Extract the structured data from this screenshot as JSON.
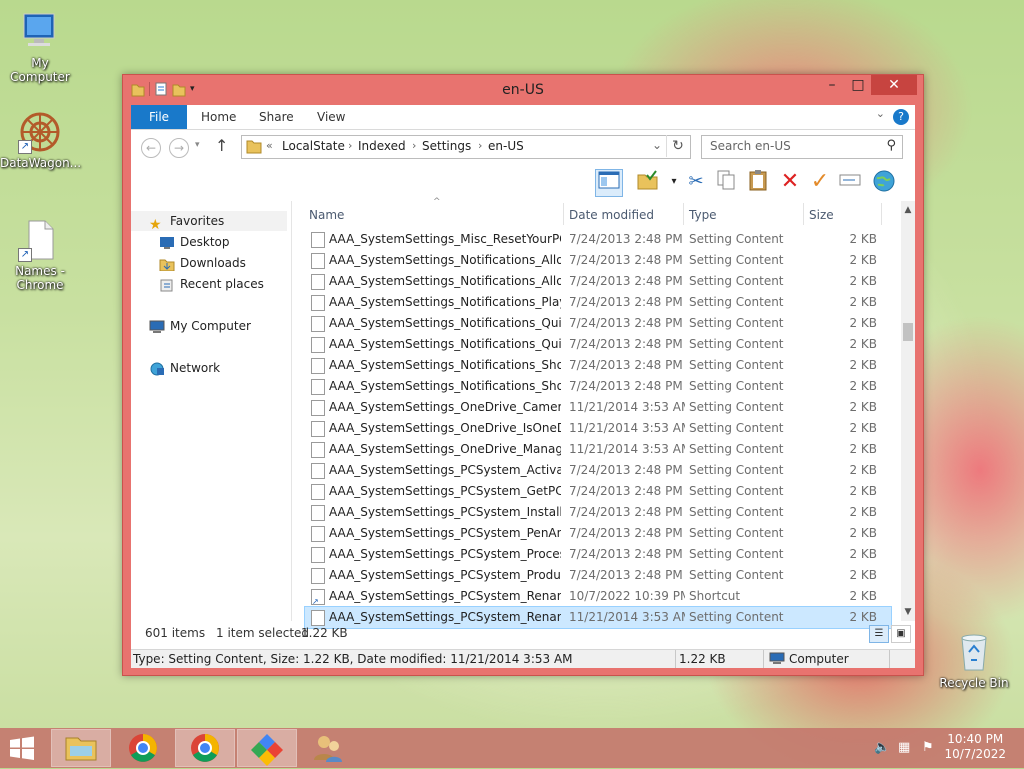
{
  "desktop": {
    "icons": [
      {
        "label": "My Computer"
      },
      {
        "label": "DataWagon..."
      },
      {
        "label": "Names - Chrome"
      },
      {
        "label": "Recycle Bin"
      }
    ]
  },
  "window": {
    "title": "en-US",
    "ribbon_tabs": [
      "File",
      "Home",
      "Share",
      "View"
    ],
    "help_label": "?",
    "address": {
      "prefix": "«",
      "crumbs": [
        "LocalState",
        "Indexed",
        "Settings",
        "en-US"
      ]
    },
    "search_placeholder": "Search en-US",
    "nav_pane": {
      "favorites": "Favorites",
      "favorites_items": [
        "Desktop",
        "Downloads",
        "Recent places"
      ],
      "computer": "My Computer",
      "network": "Network"
    },
    "columns": {
      "name": "Name",
      "date": "Date modified",
      "type": "Type",
      "size": "Size"
    },
    "files": [
      {
        "name": "AAA_SystemSettings_Misc_ResetYourPC",
        "date": "7/24/2013 2:48 PM",
        "type": "Setting Content",
        "size": "2 KB"
      },
      {
        "name": "AAA_SystemSettings_Notifications_Allow...",
        "date": "7/24/2013 2:48 PM",
        "type": "Setting Content",
        "size": "2 KB"
      },
      {
        "name": "AAA_SystemSettings_Notifications_Allow...",
        "date": "7/24/2013 2:48 PM",
        "type": "Setting Content",
        "size": "2 KB"
      },
      {
        "name": "AAA_SystemSettings_Notifications_PlayS...",
        "date": "7/24/2013 2:48 PM",
        "type": "Setting Content",
        "size": "2 KB"
      },
      {
        "name": "AAA_SystemSettings_Notifications_Quiet...",
        "date": "7/24/2013 2:48 PM",
        "type": "Setting Content",
        "size": "2 KB"
      },
      {
        "name": "AAA_SystemSettings_Notifications_Quiet...",
        "date": "7/24/2013 2:48 PM",
        "type": "Setting Content",
        "size": "2 KB"
      },
      {
        "name": "AAA_SystemSettings_Notifications_Show...",
        "date": "7/24/2013 2:48 PM",
        "type": "Setting Content",
        "size": "2 KB"
      },
      {
        "name": "AAA_SystemSettings_Notifications_Show...",
        "date": "7/24/2013 2:48 PM",
        "type": "Setting Content",
        "size": "2 KB"
      },
      {
        "name": "AAA_SystemSettings_OneDrive_CameraR...",
        "date": "11/21/2014 3:53 AM",
        "type": "Setting Content",
        "size": "2 KB"
      },
      {
        "name": "AAA_SystemSettings_OneDrive_IsOneDri...",
        "date": "11/21/2014 3:53 AM",
        "type": "Setting Content",
        "size": "2 KB"
      },
      {
        "name": "AAA_SystemSettings_OneDrive_Manage...",
        "date": "11/21/2014 3:53 AM",
        "type": "Setting Content",
        "size": "2 KB"
      },
      {
        "name": "AAA_SystemSettings_PCSystem_Activate...",
        "date": "7/24/2013 2:48 PM",
        "type": "Setting Content",
        "size": "2 KB"
      },
      {
        "name": "AAA_SystemSettings_PCSystem_GetPCN...",
        "date": "7/24/2013 2:48 PM",
        "type": "Setting Content",
        "size": "2 KB"
      },
      {
        "name": "AAA_SystemSettings_PCSystem_Installed...",
        "date": "7/24/2013 2:48 PM",
        "type": "Setting Content",
        "size": "2 KB"
      },
      {
        "name": "AAA_SystemSettings_PCSystem_PenAnd...",
        "date": "7/24/2013 2:48 PM",
        "type": "Setting Content",
        "size": "2 KB"
      },
      {
        "name": "AAA_SystemSettings_PCSystem_Process...",
        "date": "7/24/2013 2:48 PM",
        "type": "Setting Content",
        "size": "2 KB"
      },
      {
        "name": "AAA_SystemSettings_PCSystem_ProductI...",
        "date": "7/24/2013 2:48 PM",
        "type": "Setting Content",
        "size": "2 KB"
      },
      {
        "name": "AAA_SystemSettings_PCSystem_Rename...",
        "date": "10/7/2022 10:39 PM",
        "type": "Shortcut",
        "size": "2 KB",
        "shortcut": true
      },
      {
        "name": "AAA_SystemSettings_PCSystem_Rename...",
        "date": "11/21/2014 3:53 AM",
        "type": "Setting Content",
        "size": "2 KB",
        "selected": true
      }
    ],
    "status": {
      "count": "601 items",
      "selected": "1 item selected",
      "size": "1.22 KB"
    },
    "details_bar": {
      "info": "Type: Setting Content, Size: 1.22 KB, Date modified: 11/21/2014 3:53 AM",
      "size": "1.22 KB",
      "location": "Computer"
    }
  },
  "taskbar": {
    "clock_time": "10:40 PM",
    "clock_date": "10/7/2022"
  },
  "colors": {
    "window_frame": "#e8736f",
    "close_button": "#c74440",
    "file_tab": "#1979ca",
    "selection": "#cce8ff"
  }
}
